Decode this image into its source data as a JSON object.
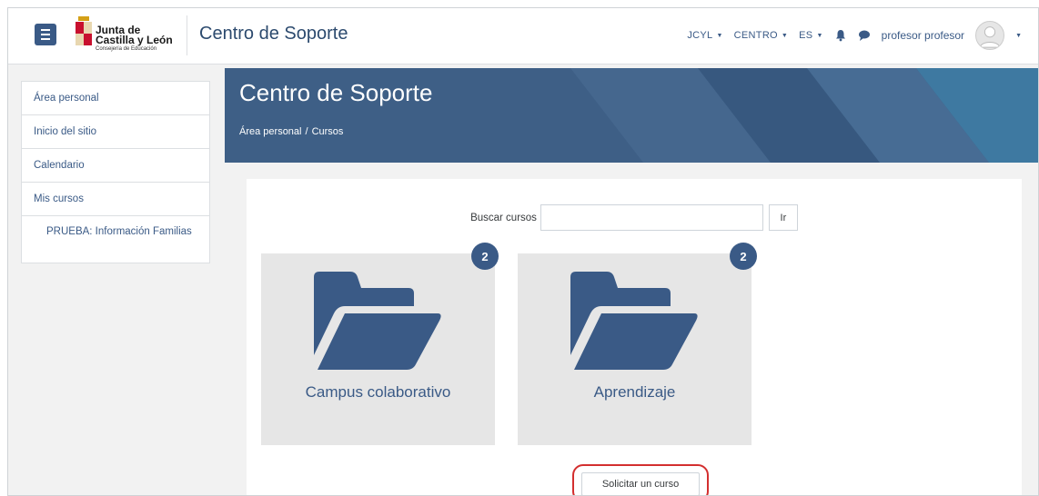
{
  "header": {
    "logo": {
      "line1": "Junta de",
      "line2": "Castilla y León",
      "line3": "Consejería de Educación"
    },
    "site_title": "Centro de Soporte",
    "menus": [
      {
        "label": "JCYL"
      },
      {
        "label": "CENTRO"
      },
      {
        "label": "ES"
      }
    ],
    "user_name": "profesor profesor",
    "icons": [
      "hamburger-menu-icon",
      "bell-icon",
      "chat-bubble-icon",
      "user-avatar-icon",
      "caret-down-icon"
    ]
  },
  "sidebar": {
    "items": [
      {
        "label": "Área personal"
      },
      {
        "label": "Inicio del sitio"
      },
      {
        "label": "Calendario"
      },
      {
        "label": "Mis cursos"
      },
      {
        "label": "PRUEBA: Información Familias"
      }
    ]
  },
  "banner": {
    "title": "Centro de Soporte",
    "breadcrumb": [
      "Área personal",
      "Cursos"
    ],
    "breadcrumb_separator": "/"
  },
  "main": {
    "search_label": "Buscar cursos",
    "search_value": "",
    "search_button": "Ir",
    "categories": [
      {
        "name": "Campus colaborativo",
        "count": "2",
        "icon": "folder-open-icon"
      },
      {
        "name": "Aprendizaje",
        "count": "2",
        "icon": "folder-open-icon"
      }
    ],
    "request_button": "Solicitar un curso"
  },
  "colors": {
    "primary": "#3a5a86",
    "banner": "#3e5f86",
    "highlight": "#d32f2f",
    "card_bg": "#e6e6e6"
  }
}
